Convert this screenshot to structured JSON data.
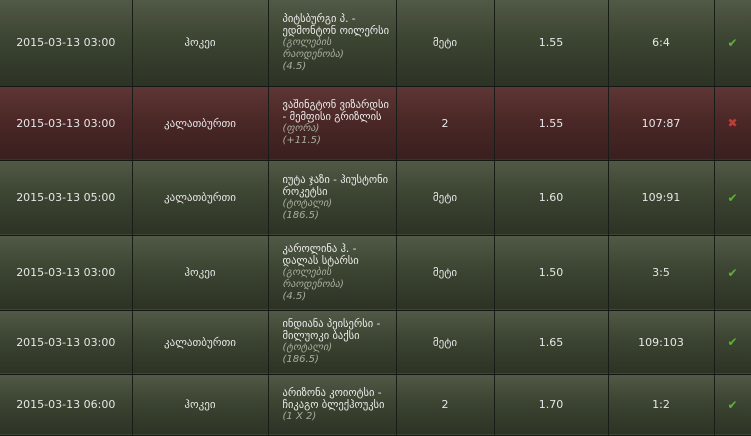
{
  "rows": [
    {
      "date": "2015-03-13 03:00",
      "sport": "ჰოკეი",
      "event": "პიტსბურგი პ. - ედმონტონ ოილერსი",
      "market": "(გოლების რაოდენობა)",
      "line": "(4.5)",
      "pick": "მეტი",
      "odds": "1.55",
      "score": "6:4",
      "status": "won",
      "status_glyph": "✔",
      "status_color": "#5fb23a"
    },
    {
      "date": "2015-03-13 03:00",
      "sport": "კალათბურთი",
      "event": "ვაშინგტონ ვიზარდსი - მემფისი გრიზლის",
      "market": "(ფორა)",
      "line": "(+11.5)",
      "pick": "2",
      "odds": "1.55",
      "score": "107:87",
      "status": "lost",
      "status_glyph": "✖",
      "status_color": "#c43c37"
    },
    {
      "date": "2015-03-13 05:00",
      "sport": "კალათბურთი",
      "event": "იუტა ჯაზი - ჰიუსტონი როკეტსი",
      "market": "(ტოტალი)",
      "line": "(186.5)",
      "pick": "მეტი",
      "odds": "1.60",
      "score": "109:91",
      "status": "won",
      "status_glyph": "✔",
      "status_color": "#5fb23a"
    },
    {
      "date": "2015-03-13 03:00",
      "sport": "ჰოკეი",
      "event": "კაროლინა ჰ. - დალას სტარსი",
      "market": "(გოლების რაოდენობა)",
      "line": "(4.5)",
      "pick": "მეტი",
      "odds": "1.50",
      "score": "3:5",
      "status": "won",
      "status_glyph": "✔",
      "status_color": "#5fb23a"
    },
    {
      "date": "2015-03-13 03:00",
      "sport": "კალათბურთი",
      "event": "ინდიანა პეისერსი - მილუოკი ბაქსი",
      "market": "(ტოტალი)",
      "line": "(186.5)",
      "pick": "მეტი",
      "odds": "1.65",
      "score": "109:103",
      "status": "won",
      "status_glyph": "✔",
      "status_color": "#5fb23a"
    },
    {
      "date": "2015-03-13 06:00",
      "sport": "ჰოკეი",
      "event": "არიზონა კოიოტსი - ჩიკაგო ბლექჰოუკსი",
      "market": "(1 X 2)",
      "line": "",
      "pick": "2",
      "odds": "1.70",
      "score": "1:2",
      "status": "won",
      "status_glyph": "✔",
      "status_color": "#5fb23a"
    }
  ]
}
